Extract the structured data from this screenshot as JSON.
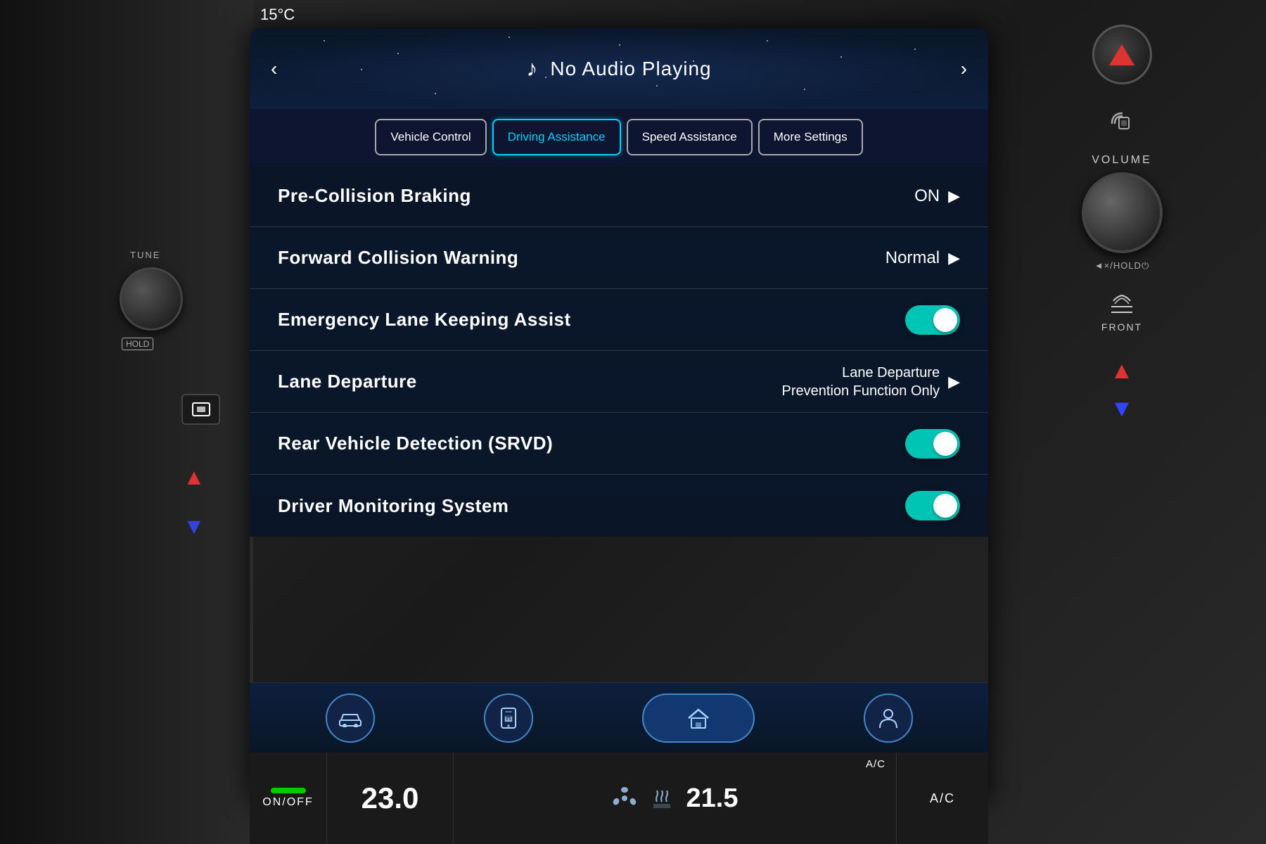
{
  "screen": {
    "temp_badge": "15°C",
    "media_bar": {
      "no_audio": "No Audio Playing",
      "prev_btn": "‹",
      "next_btn": "›"
    },
    "tabs": [
      {
        "id": "vehicle-control",
        "label": "Vehicle Control",
        "active": false
      },
      {
        "id": "driving-assistance",
        "label": "Driving Assistance",
        "active": true
      },
      {
        "id": "speed-assistance",
        "label": "Speed Assistance",
        "active": false
      },
      {
        "id": "more-settings",
        "label": "More Settings",
        "active": false
      }
    ],
    "settings": [
      {
        "id": "pre-collision-braking",
        "label": "Pre-Collision Braking",
        "type": "value-arrow",
        "value": "ON",
        "toggle": null
      },
      {
        "id": "forward-collision-warning",
        "label": "Forward Collision Warning",
        "type": "value-arrow",
        "value": "Normal",
        "toggle": null
      },
      {
        "id": "emergency-lane-keeping",
        "label": "Emergency Lane Keeping Assist",
        "type": "toggle",
        "value": null,
        "toggle": true
      },
      {
        "id": "lane-departure",
        "label": "Lane Departure",
        "type": "value-arrow-multiline",
        "value": "Lane Departure\nPrevention Function Only",
        "value_line1": "Lane Departure",
        "value_line2": "Prevention Function Only",
        "toggle": null
      },
      {
        "id": "rear-vehicle-detection",
        "label": "Rear Vehicle Detection (SRVD)",
        "type": "toggle",
        "value": null,
        "toggle": true
      },
      {
        "id": "driver-monitoring",
        "label": "Driver Monitoring System",
        "type": "toggle",
        "value": null,
        "toggle": true
      }
    ],
    "nav_buttons": [
      {
        "id": "car",
        "icon": "🚗"
      },
      {
        "id": "phone",
        "icon": "📱"
      },
      {
        "id": "home",
        "icon": "🏠"
      },
      {
        "id": "person",
        "icon": "👤"
      }
    ],
    "climate": {
      "onoff_label": "ON/OFF",
      "temp_left": "23.0",
      "ac_label": "A/C",
      "temp_right": "21.5",
      "ac_right": "A/C"
    }
  },
  "right_panel": {
    "volume_label": "VOLUME",
    "mute_hold": "◄×/HOLD⏻",
    "front_label": "FRONT",
    "tune_label": "TUNE",
    "hold_label": "HOLD"
  }
}
